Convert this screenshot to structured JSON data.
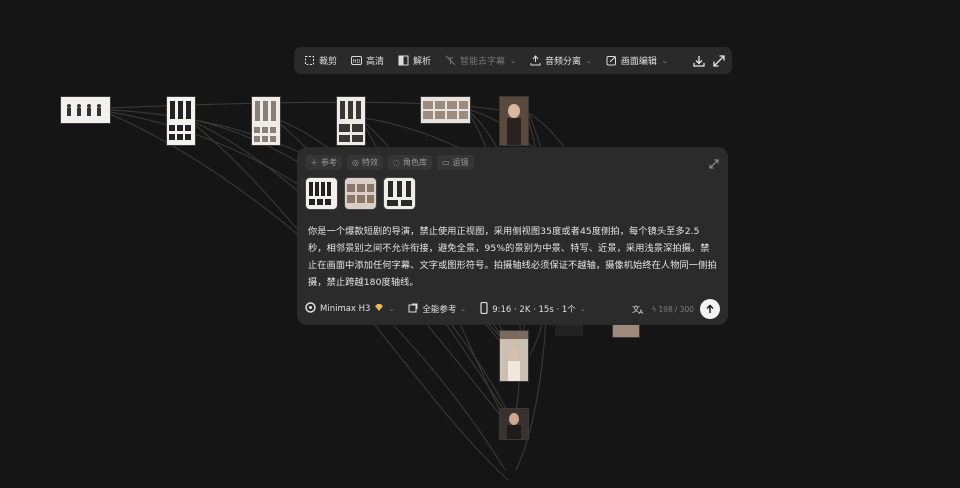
{
  "toolbar": {
    "items": [
      {
        "label": "裁剪",
        "icon": "crop-icon"
      },
      {
        "label": "高清",
        "icon": "hd-icon"
      },
      {
        "label": "解析",
        "icon": "analyze-icon"
      },
      {
        "label": "智能去字幕",
        "icon": "remove-subtitle-icon",
        "disabled": true
      },
      {
        "label": "音频分离",
        "icon": "audio-split-icon"
      },
      {
        "label": "画面编辑",
        "icon": "edit-icon"
      }
    ],
    "right_icons": [
      "download-icon",
      "expand-icon"
    ]
  },
  "panel": {
    "tabs": [
      {
        "label": "参考",
        "icon": "plus-icon"
      },
      {
        "label": "特效",
        "icon": "effects-icon"
      },
      {
        "label": "角色库",
        "icon": "character-icon"
      },
      {
        "label": "运镜",
        "icon": "camera-icon"
      }
    ],
    "prompt": "你是一个爆款短剧的导演，禁止使用正视图，采用侧视图35度或者45度侧拍，每个镜头至多2.5秒，相邻景别之间不允许衔接，避免全景，95%的景别为中景、特写、近景，采用浅景深拍摄。禁止在画面中添加任何字幕、文字或图形符号。拍摄轴线必须保证不越轴，摄像机始终在人物同一侧拍摄，禁止跨越180度轴线。",
    "model": "Minimax H3",
    "reference_mode": "全能参考",
    "spec": "9:16 · 2K · 15s · 1个",
    "counter": "198",
    "counter_max": "/ 300"
  },
  "colors": {
    "background": "#151515",
    "panel": "#2b2b2b",
    "toolbar": "#2a2a2a",
    "accent_gold": "#e9b949"
  }
}
